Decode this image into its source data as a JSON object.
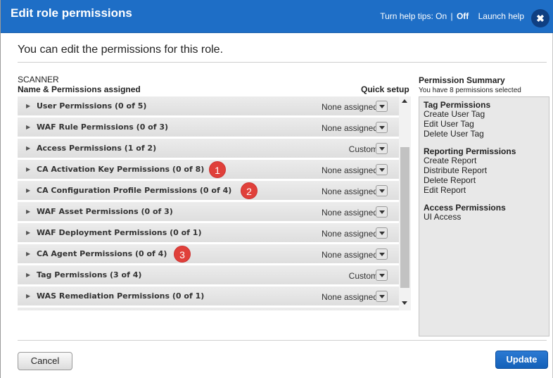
{
  "dialog": {
    "title": "Edit role permissions",
    "help_prefix": "Turn help tips: On",
    "help_sep": "|",
    "help_off": "Off",
    "launch_help": "Launch help",
    "close_glyph": "✖",
    "subtitle": "You can edit the permissions for this role."
  },
  "role": {
    "name": "SCANNER",
    "col_name": "Name & Permissions assigned",
    "col_quick": "Quick setup"
  },
  "permissions": [
    {
      "label": "User Permissions (0 of 5)",
      "quick": "None assigned"
    },
    {
      "label": "WAF Rule Permissions (0 of 3)",
      "quick": "None assigned"
    },
    {
      "label": "Access Permissions (1 of 2)",
      "quick": "Custom"
    },
    {
      "label": "CA Activation Key Permissions (0 of 8)",
      "quick": "None assigned"
    },
    {
      "label": "CA Configuration Profile Permissions (0 of 4)",
      "quick": "None assigned"
    },
    {
      "label": "WAF Asset Permissions (0 of 3)",
      "quick": "None assigned"
    },
    {
      "label": "WAF Deployment Permissions (0 of 1)",
      "quick": "None assigned"
    },
    {
      "label": "CA Agent Permissions (0 of 4)",
      "quick": "None assigned"
    },
    {
      "label": "Tag Permissions (3 of 4)",
      "quick": "Custom"
    },
    {
      "label": "WAS Remediation Permissions (0 of 1)",
      "quick": "None assigned"
    }
  ],
  "badges": [
    "1",
    "2",
    "3"
  ],
  "summary": {
    "title": "Permission Summary",
    "subtitle": "You have 8 permissions selected",
    "groups": [
      {
        "heading": "Tag Permissions",
        "items": [
          "Create User Tag",
          "Edit User Tag",
          "Delete User Tag"
        ]
      },
      {
        "heading": "Reporting Permissions",
        "items": [
          "Create Report",
          "Distribute Report",
          "Delete Report",
          "Edit Report"
        ]
      },
      {
        "heading": "Access Permissions",
        "items": [
          "UI Access"
        ]
      }
    ]
  },
  "footer": {
    "cancel": "Cancel",
    "update": "Update"
  },
  "colors": {
    "titlebar": "#1e6ec6",
    "badge": "#e0403a",
    "update_button": "#1a6cc4"
  }
}
